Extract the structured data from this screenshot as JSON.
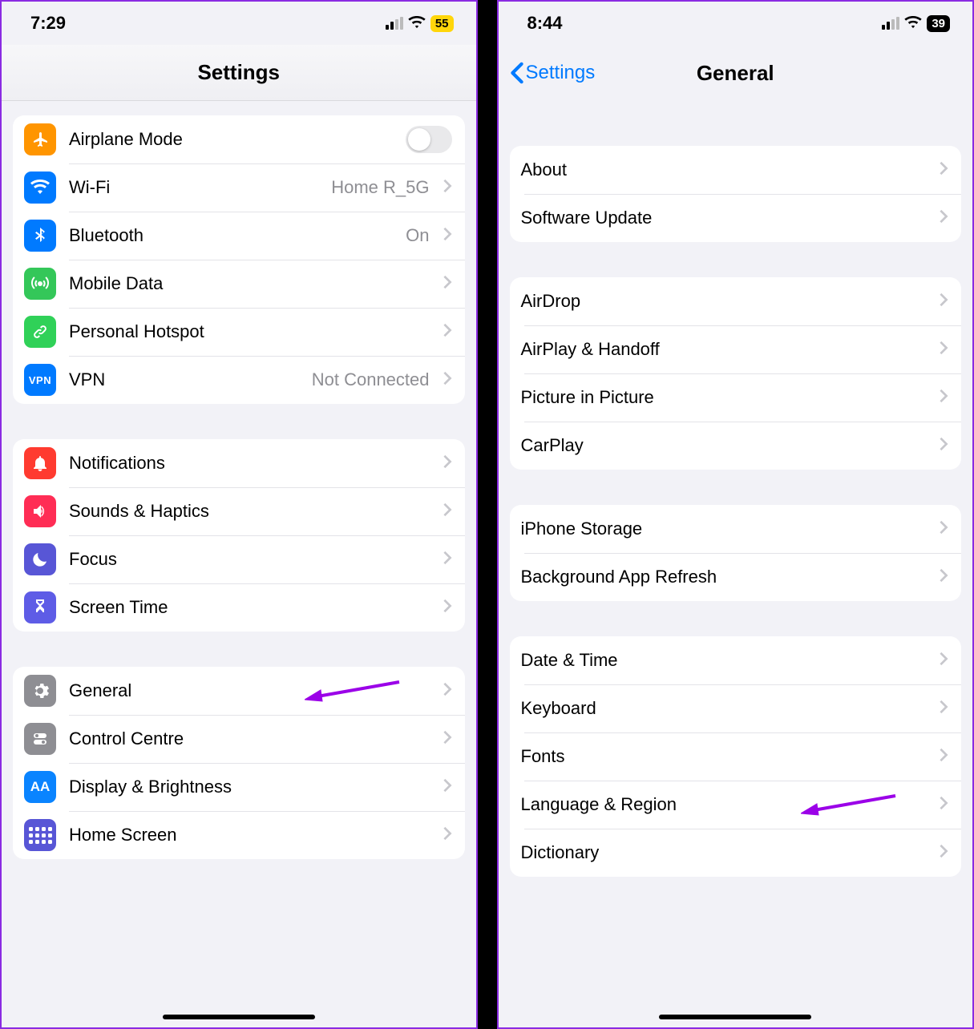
{
  "left": {
    "time": "7:29",
    "battery": "55",
    "title": "Settings",
    "groups": [
      [
        {
          "id": "airplane",
          "label": "Airplane Mode",
          "icon": "airplane",
          "bg": "bg-orange",
          "toggle": true
        },
        {
          "id": "wifi",
          "label": "Wi-Fi",
          "icon": "wifi",
          "bg": "bg-blue",
          "value": "Home R_5G",
          "chevron": true
        },
        {
          "id": "bluetooth",
          "label": "Bluetooth",
          "icon": "bluetooth",
          "bg": "bg-btblue",
          "value": "On",
          "chevron": true
        },
        {
          "id": "mobiledata",
          "label": "Mobile Data",
          "icon": "antenna",
          "bg": "bg-green",
          "chevron": true
        },
        {
          "id": "hotspot",
          "label": "Personal Hotspot",
          "icon": "link",
          "bg": "bg-green2",
          "chevron": true
        },
        {
          "id": "vpn",
          "label": "VPN",
          "icon": "vpn",
          "bg": "bg-vpn",
          "value": "Not Connected",
          "chevron": true
        }
      ],
      [
        {
          "id": "notifications",
          "label": "Notifications",
          "icon": "bell",
          "bg": "bg-red",
          "chevron": true
        },
        {
          "id": "sounds",
          "label": "Sounds & Haptics",
          "icon": "speaker",
          "bg": "bg-pink",
          "chevron": true
        },
        {
          "id": "focus",
          "label": "Focus",
          "icon": "moon",
          "bg": "bg-indigo",
          "chevron": true
        },
        {
          "id": "screentime",
          "label": "Screen Time",
          "icon": "hourglass",
          "bg": "bg-indigo2",
          "chevron": true
        }
      ],
      [
        {
          "id": "general",
          "label": "General",
          "icon": "gear",
          "bg": "bg-gray",
          "chevron": true,
          "annot": true
        },
        {
          "id": "controlcentre",
          "label": "Control Centre",
          "icon": "switches",
          "bg": "bg-gray2",
          "chevron": true
        },
        {
          "id": "display",
          "label": "Display & Brightness",
          "icon": "aa",
          "bg": "bg-dblue",
          "chevron": true
        },
        {
          "id": "homescreen",
          "label": "Home Screen",
          "icon": "homegrid",
          "bg": "bg-home",
          "chevron": true
        }
      ]
    ]
  },
  "right": {
    "time": "8:44",
    "battery": "39",
    "back": "Settings",
    "title": "General",
    "groups": [
      [
        {
          "id": "about",
          "label": "About",
          "chevron": true
        },
        {
          "id": "swupdate",
          "label": "Software Update",
          "chevron": true
        }
      ],
      [
        {
          "id": "airdrop",
          "label": "AirDrop",
          "chevron": true
        },
        {
          "id": "airplay",
          "label": "AirPlay & Handoff",
          "chevron": true
        },
        {
          "id": "pip",
          "label": "Picture in Picture",
          "chevron": true
        },
        {
          "id": "carplay",
          "label": "CarPlay",
          "chevron": true
        }
      ],
      [
        {
          "id": "storage",
          "label": "iPhone Storage",
          "chevron": true
        },
        {
          "id": "bgrefresh",
          "label": "Background App Refresh",
          "chevron": true
        }
      ],
      [
        {
          "id": "datetime",
          "label": "Date & Time",
          "chevron": true
        },
        {
          "id": "keyboard",
          "label": "Keyboard",
          "chevron": true
        },
        {
          "id": "fonts",
          "label": "Fonts",
          "chevron": true
        },
        {
          "id": "langregion",
          "label": "Language & Region",
          "chevron": true,
          "annot": true
        },
        {
          "id": "dictionary",
          "label": "Dictionary",
          "chevron": true
        }
      ]
    ]
  }
}
